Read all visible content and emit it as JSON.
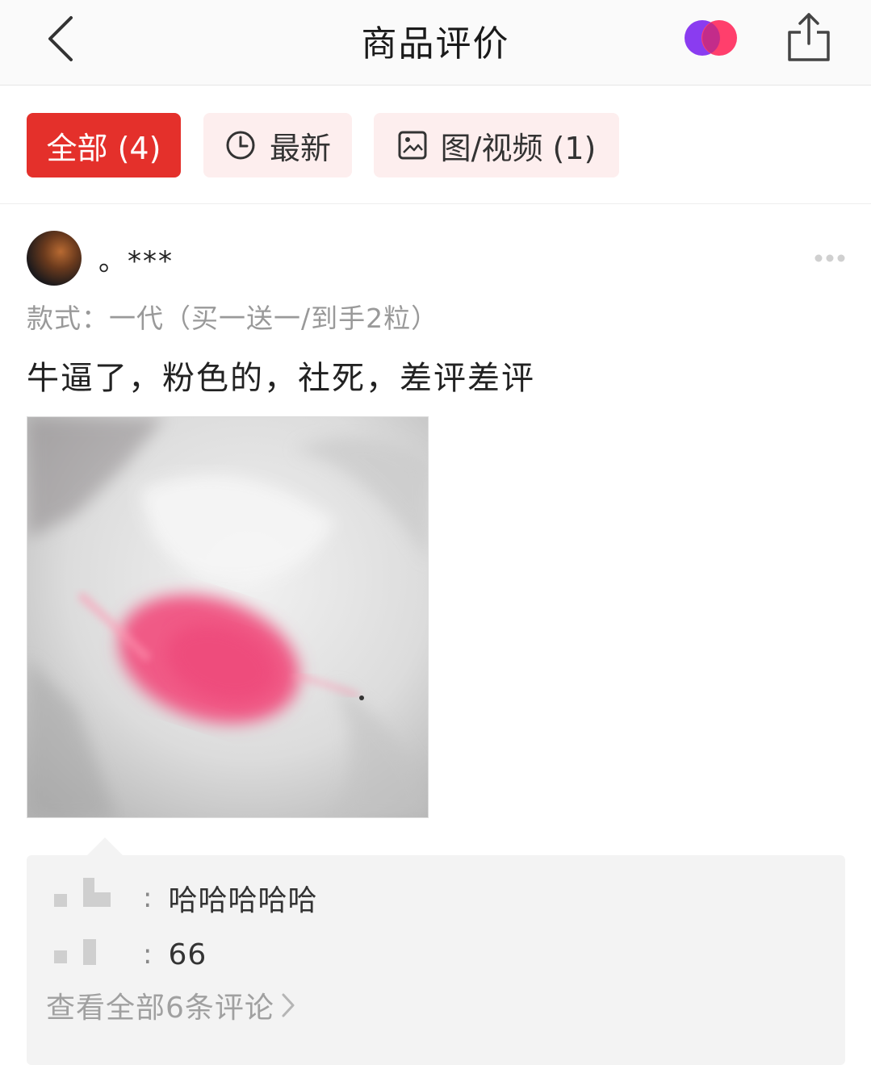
{
  "header": {
    "title": "商品评价",
    "back_icon": "chevron-left-icon",
    "logo_icon": "partner-logo-icon",
    "share_icon": "share-icon"
  },
  "filters": {
    "tabs": [
      {
        "label": "全部 (4)",
        "active": true
      },
      {
        "label": "最新",
        "icon": "clock-icon",
        "active": false
      },
      {
        "label": "图/视频 (1)",
        "icon": "image-icon",
        "active": false
      }
    ]
  },
  "review": {
    "username": "。***",
    "spec": "款式：一代（买一送一/到手2粒）",
    "text": "牛逼了，粉色的，社死，差评差评",
    "more_icon": "more-dots-icon",
    "photo_icon": "review-photo"
  },
  "comments": {
    "items": [
      {
        "text": "哈哈哈哈哈"
      },
      {
        "text": "66"
      }
    ],
    "view_all": "查看全部6条评论",
    "view_all_icon": "chevron-right-icon"
  },
  "colors": {
    "accent": "#e4302b",
    "tab_inactive_bg": "#fdeeee",
    "muted_text": "#999999"
  }
}
